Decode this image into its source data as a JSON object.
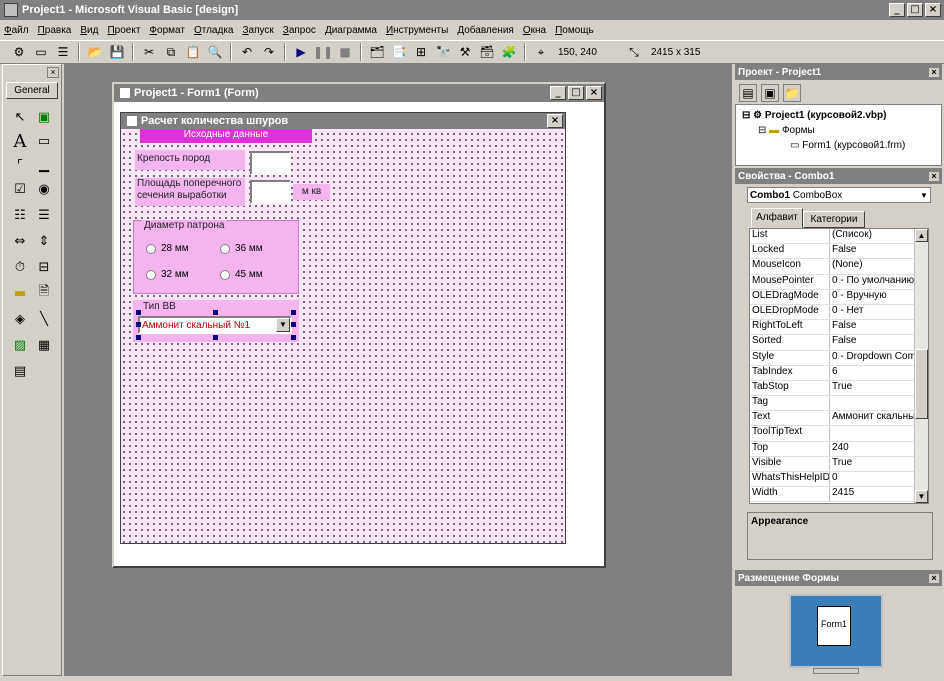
{
  "window": {
    "title": "Project1 - Microsoft Visual Basic [design]"
  },
  "menu": [
    "Файл",
    "Правка",
    "Вид",
    "Проект",
    "Формат",
    "Отладка",
    "Запуск",
    "Запрос",
    "Диаграмма",
    "Инструменты",
    "Добавления",
    "Окна",
    "Помощь"
  ],
  "toolbar": {
    "position": "150, 240",
    "size": "2415 x 315"
  },
  "toolbox": {
    "title": "General"
  },
  "form_window": {
    "title": "Project1 - Form1 (Form)"
  },
  "designer": {
    "title": "Расчет количества шпуров",
    "header": "Исходные данные",
    "label_strength": "Крепость пород",
    "label_area": "Площадь поперечного сечения выработки",
    "unit_area": "м кв",
    "frame_diameter": "Диаметр патрона",
    "radio_28": "28 мм",
    "radio_36": "36 мм",
    "radio_32": "32 мм",
    "radio_45": "45 мм",
    "label_explosive": "Тип ВВ",
    "combo_value": "Аммонит скальный №1"
  },
  "project": {
    "title": "Проект - Project1",
    "root": "Project1 (курсовой2.vbp)",
    "folder": "Формы",
    "form": "Form1 (курсовой1.frm)"
  },
  "properties": {
    "title": "Свойства - Combo1",
    "object": "Combo1",
    "object_type": "ComboBox",
    "tab_alpha": "Алфавит",
    "tab_cat": "Категории",
    "rows": [
      {
        "k": "List",
        "v": "(Список)"
      },
      {
        "k": "Locked",
        "v": "False"
      },
      {
        "k": "MouseIcon",
        "v": "(None)"
      },
      {
        "k": "MousePointer",
        "v": "0 - По умолчанию"
      },
      {
        "k": "OLEDragMode",
        "v": "0 - Вручную"
      },
      {
        "k": "OLEDropMode",
        "v": "0 - Нет"
      },
      {
        "k": "RightToLeft",
        "v": "False"
      },
      {
        "k": "Sorted",
        "v": "False"
      },
      {
        "k": "Style",
        "v": "0 - Dropdown Com"
      },
      {
        "k": "TabIndex",
        "v": "6"
      },
      {
        "k": "TabStop",
        "v": "True"
      },
      {
        "k": "Tag",
        "v": ""
      },
      {
        "k": "Text",
        "v": "Аммонит скальны"
      },
      {
        "k": "ToolTipText",
        "v": ""
      },
      {
        "k": "Top",
        "v": "240"
      },
      {
        "k": "Visible",
        "v": "True"
      },
      {
        "k": "WhatsThisHelpID",
        "v": "0"
      },
      {
        "k": "Width",
        "v": "2415"
      }
    ],
    "description_title": "Appearance"
  },
  "placement": {
    "title": "Размещение Формы",
    "form_label": "Form1"
  },
  "colors": {
    "form_back": "#fce6f8",
    "control_pink": "#f6b4ee",
    "header_magenta": "#e030d8"
  }
}
